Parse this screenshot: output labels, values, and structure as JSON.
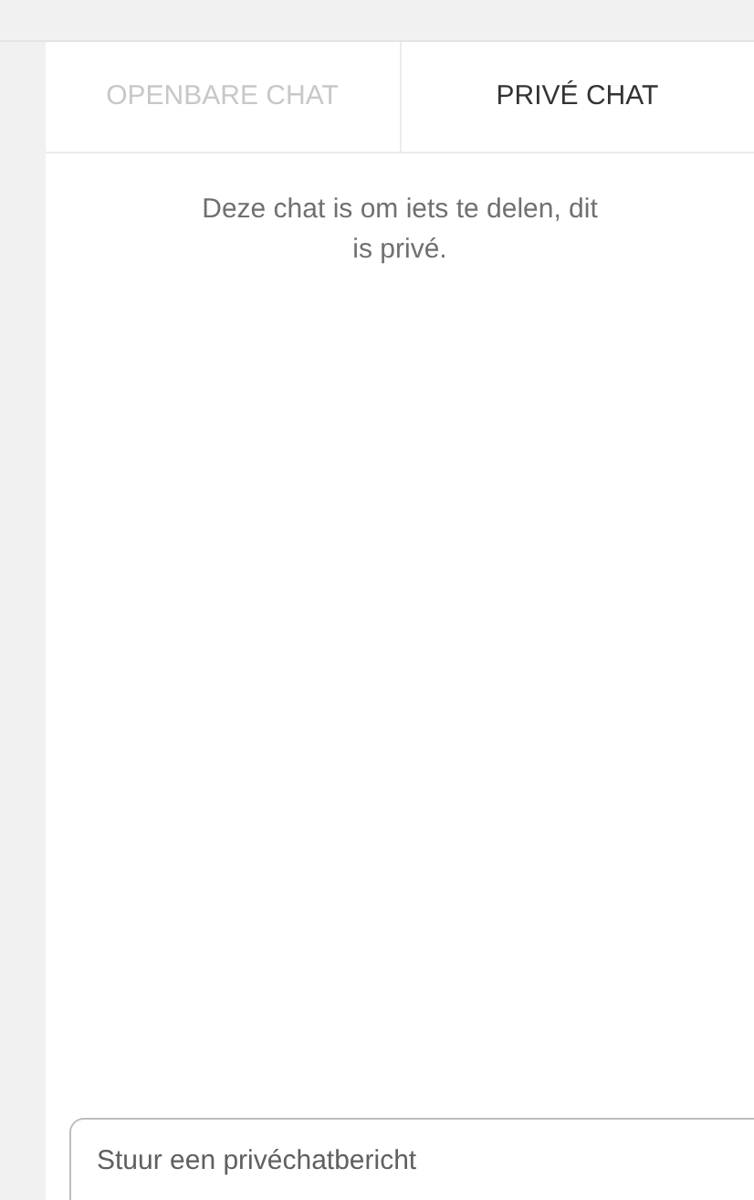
{
  "tabs": [
    {
      "label": "OPENBARE CHAT",
      "selected": false
    },
    {
      "label": "PRIVÉ CHAT",
      "selected": true
    }
  ],
  "notice": "Deze chat is om iets te delen, dit is privé.",
  "message_field": {
    "placeholder": "Stuur een privéchatbericht"
  }
}
